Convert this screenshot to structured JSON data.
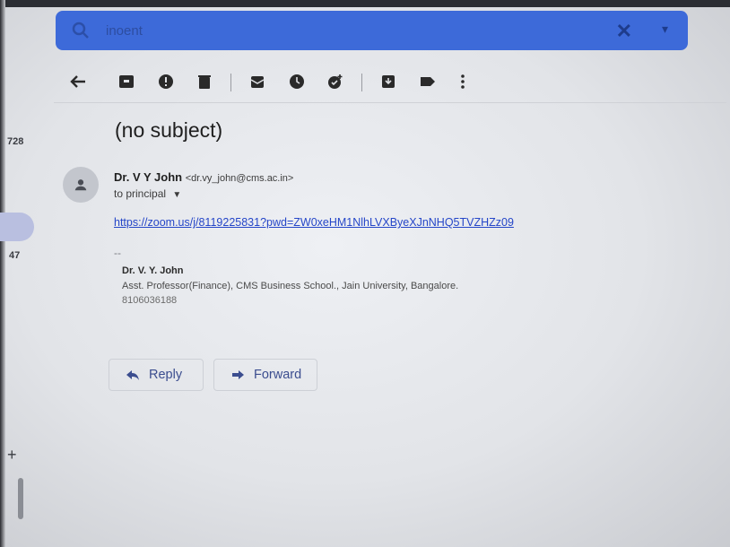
{
  "search": {
    "text": "inoent"
  },
  "toolbar": {
    "icons": [
      "back-arrow-icon",
      "archive-icon",
      "report-spam-icon",
      "delete-icon",
      "mark-unread-icon",
      "snooze-icon",
      "add-task-icon",
      "move-to-icon",
      "labels-icon",
      "more-icon"
    ]
  },
  "sidebar": {
    "count_top": "728",
    "count_mid": "47",
    "plus": "+"
  },
  "email": {
    "subject": "(no subject)",
    "sender_name": "Dr. V Y John",
    "sender_email": "<dr.vy_john@cms.ac.in>",
    "to": "to principal",
    "link": "https://zoom.us/j/8119225831?pwd=ZW0xeHM1NlhLVXByeXJnNHQ5TVZHZz09",
    "separator": "--",
    "signature": {
      "name": "Dr. V. Y. John",
      "title": "Asst. Professor(Finance), CMS Business School., Jain University, Bangalore.",
      "phone": "8106036188"
    }
  },
  "actions": {
    "reply": "Reply",
    "forward": "Forward"
  },
  "colors": {
    "search_bg": "#3d6ad9",
    "link": "#2546c8",
    "button_text": "#3b4d8f"
  }
}
